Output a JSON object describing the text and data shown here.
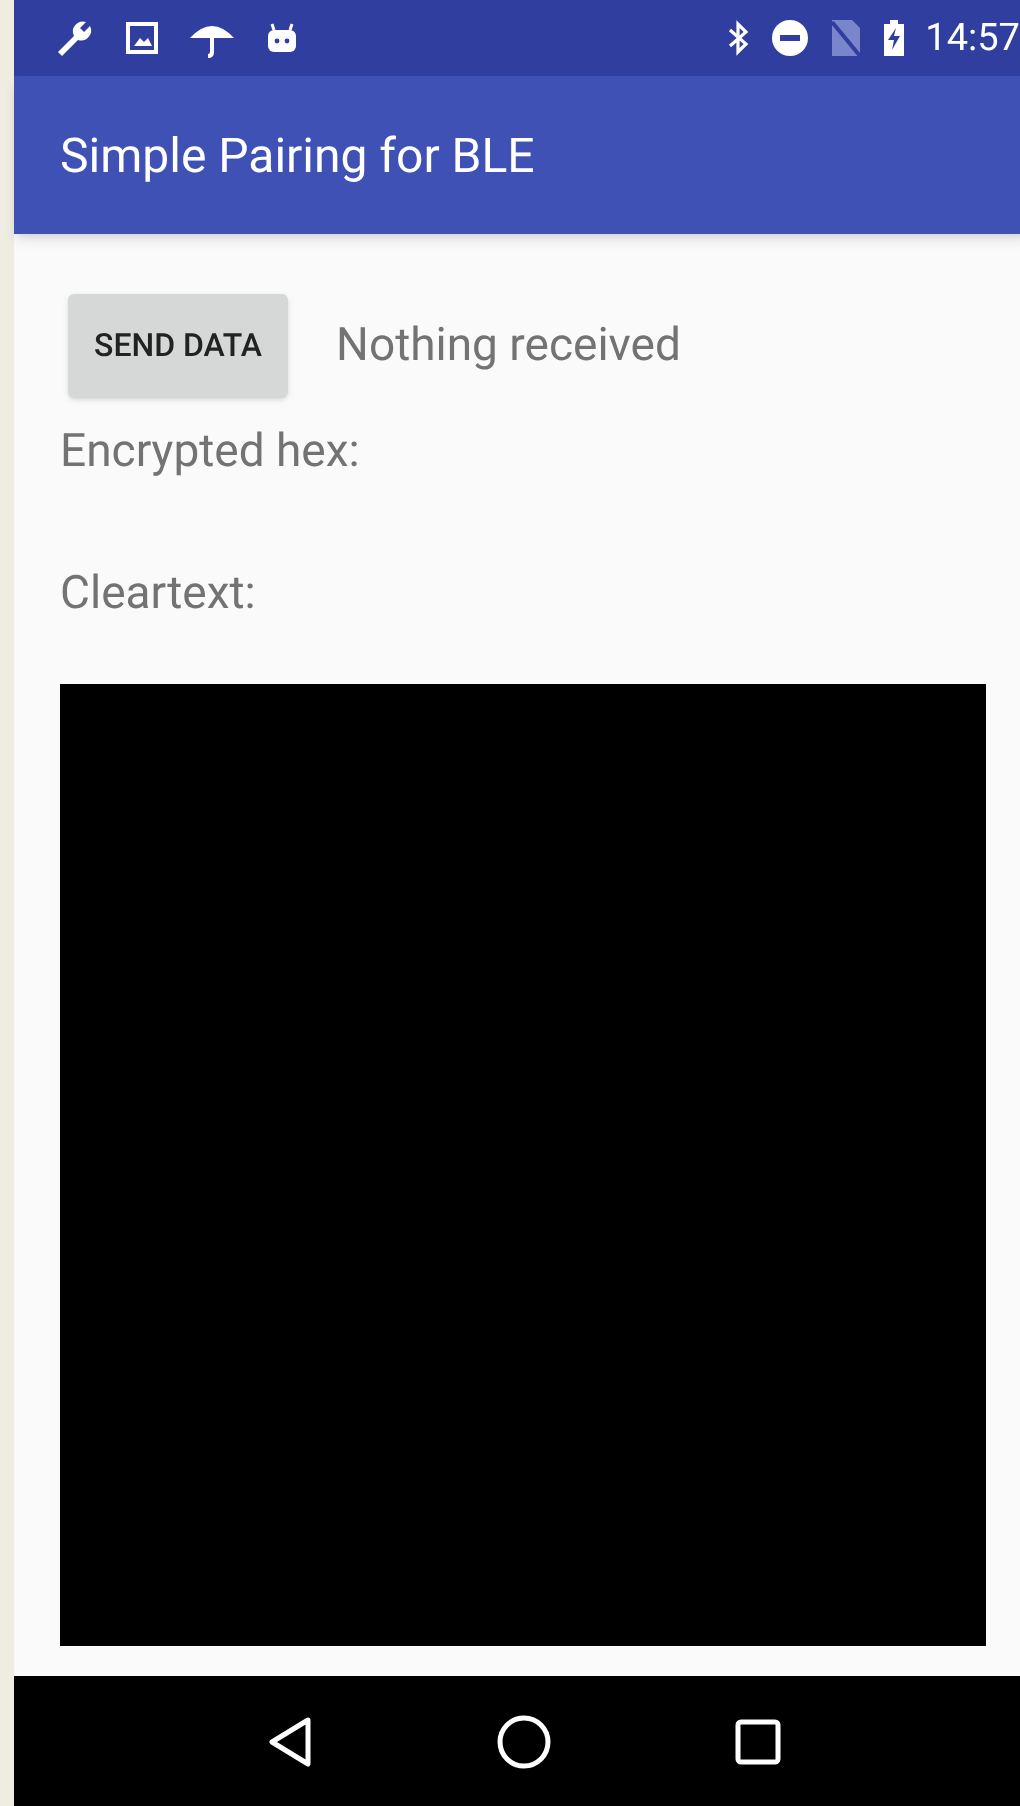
{
  "status_bar": {
    "time": "14:57"
  },
  "app_bar": {
    "title": "Simple Pairing for BLE"
  },
  "send_button": {
    "label": "SEND DATA"
  },
  "received_status": "Nothing received",
  "encrypted_label": "Encrypted hex:",
  "cleartext_label": "Cleartext:"
}
